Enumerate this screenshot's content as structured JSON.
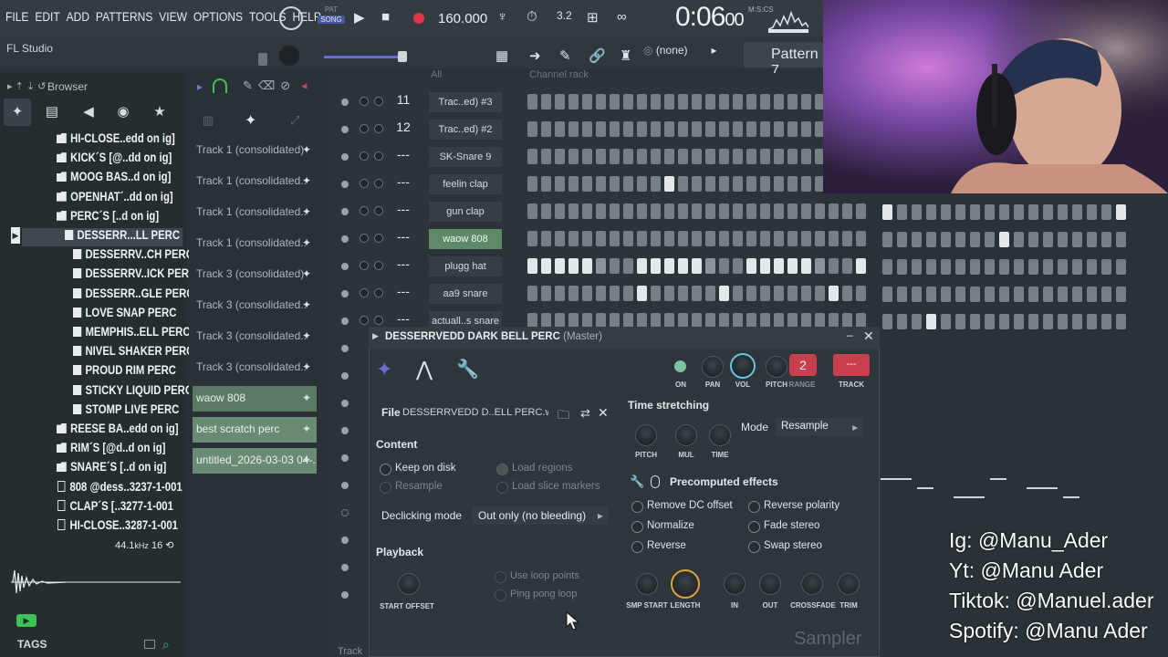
{
  "app": {
    "name": "FL Studio",
    "menu": [
      "FILE",
      "EDIT",
      "ADD",
      "PATTERNS",
      "VIEW",
      "OPTIONS",
      "TOOLS",
      "HELP"
    ],
    "mode_pat": "PAT",
    "mode_song": "SONG",
    "tempo": "160.000",
    "time_main": "0:06",
    "time_small": "00",
    "time_unit": "M:S:CS",
    "pattern": "Pattern 7",
    "pattern_none": "(none)"
  },
  "browser": {
    "title": "Browser",
    "items": [
      {
        "label": "HI-CLOSE..edd on ig]",
        "type": "folder"
      },
      {
        "label": "KICK´S [@..dd on ig]",
        "type": "folder"
      },
      {
        "label": "MOOG BAS..d on ig]",
        "type": "folder"
      },
      {
        "label": "OPENHAT´..dd on ig]",
        "type": "folder"
      },
      {
        "label": "PERC´S [..d on ig]",
        "type": "folder"
      },
      {
        "label": "DESSERR...LL PERC",
        "type": "wav",
        "selected": true
      },
      {
        "label": "DESSERRV..CH PERC",
        "type": "wav"
      },
      {
        "label": "DESSERRV..ICK PERC",
        "type": "wav"
      },
      {
        "label": "DESSERR..GLE PERC",
        "type": "wav"
      },
      {
        "label": "LOVE SNAP PERC",
        "type": "wav"
      },
      {
        "label": "MEMPHIS..ELL PERC",
        "type": "wav"
      },
      {
        "label": "NIVEL SHAKER PERC",
        "type": "wav"
      },
      {
        "label": "PROUD RIM PERC",
        "type": "wav"
      },
      {
        "label": "STICKY LIQUID PERC",
        "type": "wav"
      },
      {
        "label": "STOMP LIVE PERC",
        "type": "wav"
      },
      {
        "label": "REESE BA..edd on ig]",
        "type": "folder"
      },
      {
        "label": "RIM´S [@d..d on ig]",
        "type": "folder"
      },
      {
        "label": "SNARE´S [..d on ig]",
        "type": "folder"
      },
      {
        "label": "808 @dess..3237-1-001",
        "type": "file"
      },
      {
        "label": "CLAP´S [..3277-1-001",
        "type": "file"
      },
      {
        "label": "HI-CLOSE..3287-1-001",
        "type": "file"
      }
    ],
    "sample_rate": "44.1",
    "sample_rate_unit": "kHz",
    "bit_depth": "16",
    "tags": "TAGS"
  },
  "playlist_tracks": [
    {
      "label": "Track 1 (consolidated)",
      "style": "plain"
    },
    {
      "label": "Track 1 (consolidated..",
      "style": "plain"
    },
    {
      "label": "Track 1 (consolidated..",
      "style": "plain"
    },
    {
      "label": "Track 1 (consolidated..",
      "style": "plain"
    },
    {
      "label": "Track 3 (consolidated)",
      "style": "plain"
    },
    {
      "label": "Track 3 (consolidated..",
      "style": "plain"
    },
    {
      "label": "Track 3 (consolidated..",
      "style": "plain"
    },
    {
      "label": "Track 3 (consolidated..",
      "style": "plain"
    },
    {
      "label": "waow 808",
      "style": "green"
    },
    {
      "label": "best scratch perc",
      "style": "green2"
    },
    {
      "label": "untitled_2026-03-03 04-..",
      "style": "green2"
    }
  ],
  "channel_rack": {
    "title": "Channel rack",
    "filter": "All",
    "channels": [
      {
        "num": "11",
        "name": "Trac..ed) #3",
        "steps": [
          0,
          0,
          0,
          0,
          0,
          0,
          0,
          0,
          0,
          0,
          0,
          0,
          0,
          0,
          0,
          0,
          0,
          0,
          0,
          0,
          0,
          0,
          0,
          0,
          0
        ]
      },
      {
        "num": "12",
        "name": "Trac..ed) #2",
        "steps": [
          0,
          0,
          0,
          0,
          0,
          0,
          0,
          0,
          0,
          0,
          0,
          0,
          0,
          0,
          0,
          0,
          0,
          0,
          0,
          0,
          0,
          0,
          0,
          0,
          0
        ]
      },
      {
        "num": "---",
        "name": "SK-Snare 9",
        "steps": [
          0,
          0,
          0,
          0,
          0,
          0,
          0,
          0,
          0,
          0,
          0,
          0,
          0,
          0,
          0,
          0,
          0,
          0,
          0,
          0,
          0,
          0,
          0,
          0,
          0
        ]
      },
      {
        "num": "---",
        "name": "feelin clap",
        "steps": [
          0,
          0,
          0,
          0,
          0,
          0,
          0,
          0,
          0,
          0,
          1,
          0,
          0,
          0,
          0,
          0,
          0,
          0,
          0,
          0,
          0,
          0,
          0,
          0,
          0
        ]
      },
      {
        "num": "---",
        "name": "gun clap",
        "steps": [
          0,
          0,
          0,
          0,
          0,
          0,
          0,
          0,
          0,
          0,
          0,
          0,
          0,
          0,
          0,
          0,
          0,
          0,
          0,
          0,
          0,
          0,
          0,
          0,
          0
        ]
      },
      {
        "num": "---",
        "name": "waow 808",
        "steps": [
          0,
          0,
          0,
          0,
          0,
          0,
          0,
          0,
          0,
          0,
          0,
          0,
          0,
          0,
          0,
          0,
          0,
          0,
          0,
          0,
          0,
          0,
          0,
          0,
          0
        ],
        "highlight": true
      },
      {
        "num": "---",
        "name": "plugg hat",
        "steps": [
          1,
          1,
          1,
          1,
          1,
          2,
          0,
          0,
          1,
          1,
          1,
          1,
          1,
          2,
          0,
          0,
          1,
          1,
          1,
          1,
          1,
          2,
          0,
          0,
          1
        ]
      },
      {
        "num": "---",
        "name": "aa9 snare",
        "steps": [
          0,
          0,
          0,
          0,
          0,
          0,
          0,
          0,
          1,
          0,
          0,
          0,
          0,
          0,
          1,
          0,
          0,
          0,
          0,
          0,
          0,
          0,
          1,
          0,
          0
        ]
      },
      {
        "num": "---",
        "name": "actuall..s snare",
        "steps": [
          0,
          0,
          0,
          0,
          0,
          0,
          0,
          0,
          0,
          0,
          0,
          0,
          0,
          0,
          0,
          0,
          0,
          0,
          0,
          0,
          0,
          0,
          0,
          0,
          0
        ]
      }
    ]
  },
  "sampler": {
    "title": "DESSERRVEDD DARK BELL PERC",
    "target": "(Master)",
    "file_label": "File",
    "file_name": "DESSERRVEDD D..ELL PERC.wav",
    "content_label": "Content",
    "keep_on_disk": "Keep on disk",
    "resample": "Resample",
    "load_regions": "Load regions",
    "load_slice_markers": "Load slice markers",
    "declicking_label": "Declicking mode",
    "declicking_value": "Out only (no bleeding)",
    "playback_label": "Playback",
    "use_loop_points": "Use loop points",
    "ping_pong_loop": "Ping pong loop",
    "start_offset": "START OFFSET",
    "time_stretching": "Time stretching",
    "mode_label": "Mode",
    "mode_value": "Resample",
    "pitch": "PITCH",
    "mul": "MUL",
    "time": "TIME",
    "precomputed": "Precomputed effects",
    "remove_dc": "Remove DC offset",
    "normalize": "Normalize",
    "reverse": "Reverse",
    "reverse_polarity": "Reverse polarity",
    "fade_stereo": "Fade stereo",
    "swap_stereo": "Swap stereo",
    "knobs_bottom": [
      "SMP START",
      "LENGTH",
      "IN",
      "OUT",
      "CROSSFADE",
      "TRIM"
    ],
    "on": "ON",
    "pan": "PAN",
    "vol": "VOL",
    "pitch_range": "PITCH",
    "range": "RANGE",
    "range_value": "2",
    "track": "TRACK",
    "track_value": "---",
    "watermark": "Sampler"
  },
  "socials": [
    "Ig: @Manu_Ader",
    "Yt: @Manu Ader",
    "Tiktok: @Manuel.ader",
    "Spotify: @Manu Ader"
  ],
  "colors": {
    "accent_green": "#5f8a68",
    "record_red": "#e0384a",
    "knob_orange": "#e1a23a",
    "range_red": "#c8404e"
  }
}
